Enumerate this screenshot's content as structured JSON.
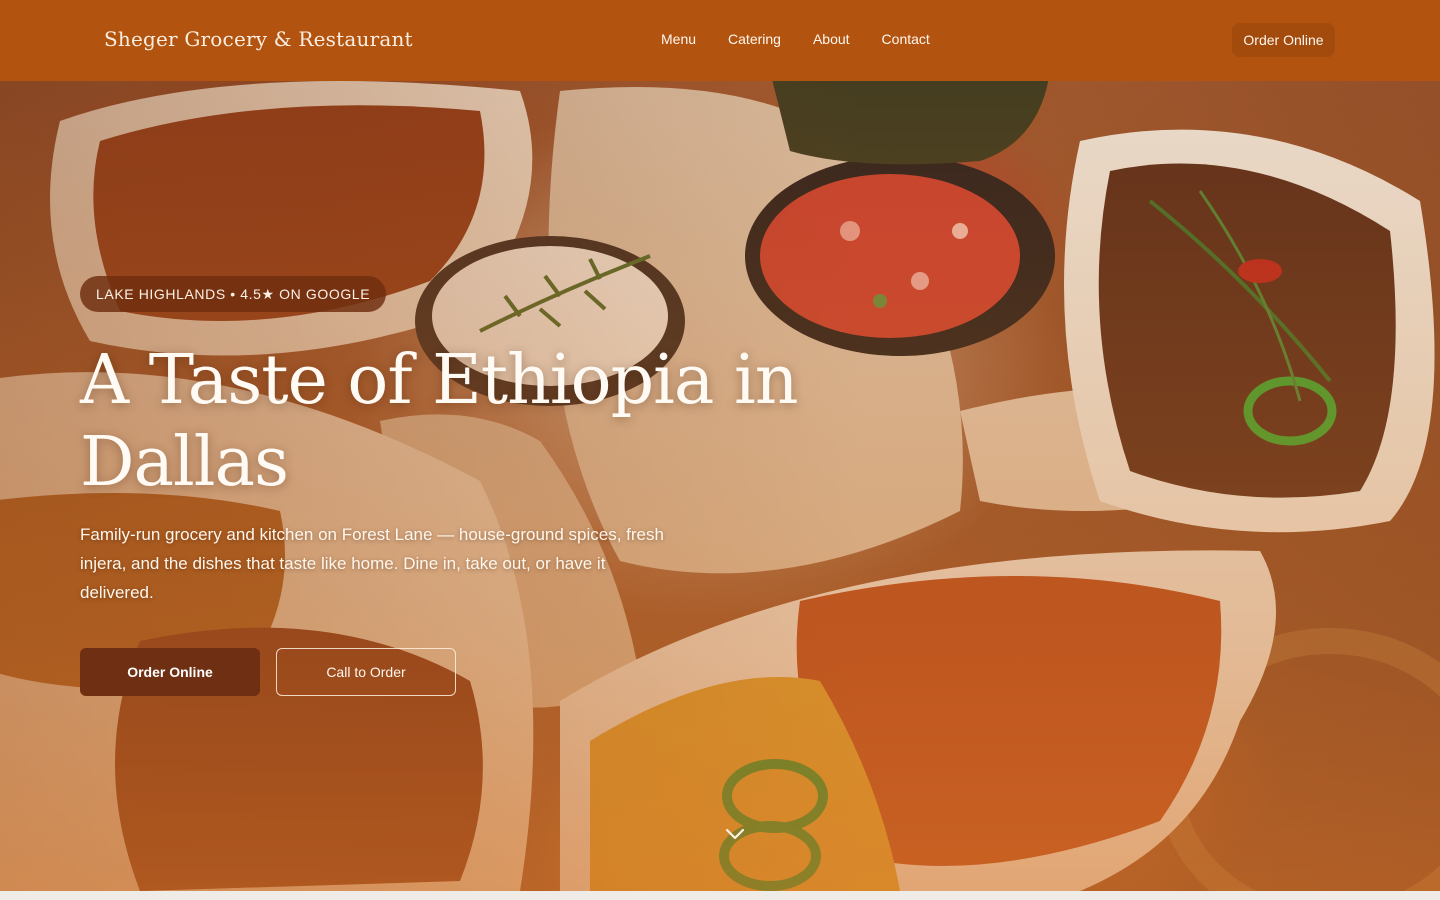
{
  "nav": {
    "brand": "Sheger Grocery & Restaurant",
    "links": [
      "Menu",
      "Catering",
      "About",
      "Contact"
    ],
    "cta": "Order Online"
  },
  "hero": {
    "badge": "LAKE HIGHLANDS • 4.5★ ON GOOGLE",
    "headline_line1": "A Taste of Ethiopia in",
    "headline_line2": "Dallas",
    "lede": "Family-run grocery and kitchen on Forest Lane — house-ground spices, fresh injera, and the dishes that taste like home. Dine in, take out, or have it delivered.",
    "primary_cta": "Order Online",
    "secondary_cta": "Call to Order",
    "scroll_icon": "chevron-down-icon"
  },
  "colors": {
    "nav_bg": "#b25410",
    "nav_cta_bg": "#a34a0d",
    "primary_button": "#6e2f12",
    "badge_bg": "#6e2d0f",
    "text_light": "#fff6ec"
  }
}
